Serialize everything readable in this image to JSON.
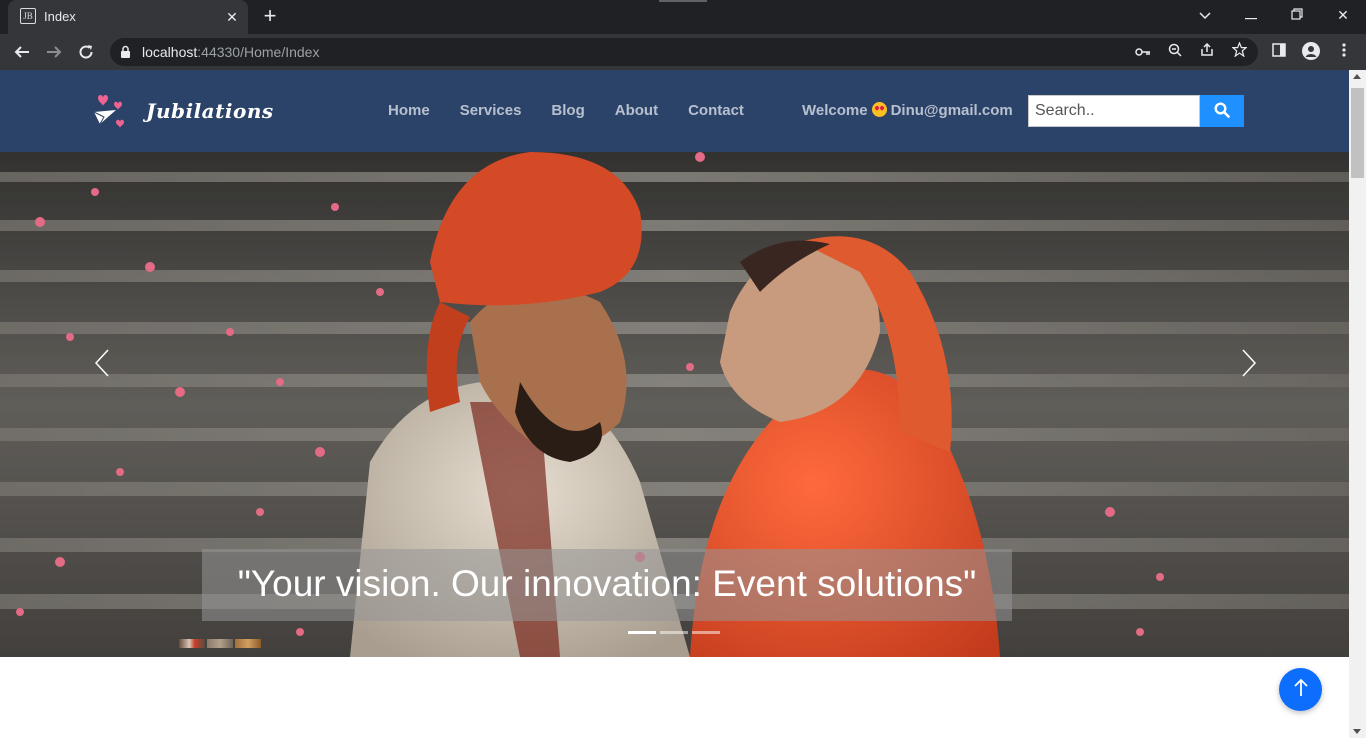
{
  "browser": {
    "tab_title": "Index",
    "tab_favicon": "JB",
    "url_host": "localhost",
    "url_rest": ":44330/Home/Index"
  },
  "site": {
    "logo_text": "Jubilations",
    "nav": [
      "Home",
      "Services",
      "Blog",
      "About",
      "Contact"
    ],
    "welcome_prefix": "Welcome",
    "welcome_user": "Dinu@gmail.com",
    "search_placeholder": "Search.."
  },
  "hero": {
    "caption": "\"Your vision. Our innovation: Event solutions\"",
    "slide_count": 3,
    "active_slide": 1
  },
  "colors": {
    "header_bg": "#2c4369",
    "nav_text": "#b7c0cf",
    "search_button": "#1e90ff",
    "back_to_top": "#0d6efd"
  },
  "icons": {
    "search_button": "search-icon",
    "back_to_top": "arrow-up-icon",
    "prev": "chevron-left-icon",
    "next": "chevron-right-icon"
  }
}
